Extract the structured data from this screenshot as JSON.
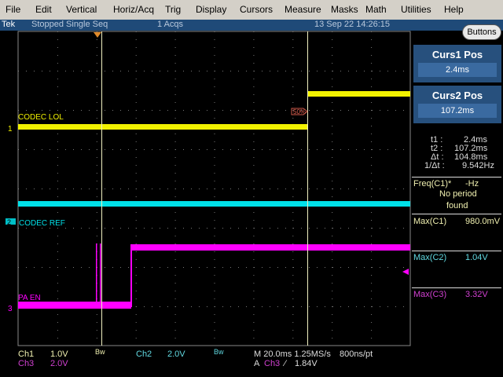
{
  "menu": [
    "File",
    "Edit",
    "Vertical",
    "Horiz/Acq",
    "Trig",
    "Display",
    "Cursors",
    "Measure",
    "Masks",
    "Math",
    "Utilities",
    "Help"
  ],
  "status": {
    "brand": "Tek",
    "state": "Stopped  Single Seq",
    "acqs": "1 Acqs",
    "datetime": "13 Sep 22 14:26:15"
  },
  "buttons_label": "Buttons",
  "cursors": {
    "curs1_title": "Curs1 Pos",
    "curs1_value": "2.4ms",
    "curs2_title": "Curs2 Pos",
    "curs2_value": "107.2ms"
  },
  "readout": {
    "t1_label": "t1 :",
    "t1": "2.4ms",
    "t2_label": "t2 :",
    "t2": "107.2ms",
    "dt_label": "Δt :",
    "dt": "104.8ms",
    "inv_label": "1/Δt :",
    "inv": "9.542Hz"
  },
  "measurements": {
    "freq_label": "Freq(C1)*",
    "freq_value": "-Hz",
    "freq_note1": "No period",
    "freq_note2": "found",
    "max1_label": "Max(C1)",
    "max1_value": "980.0mV",
    "max2_label": "Max(C2)",
    "max2_value": "1.04V",
    "max3_label": "Max(C3)",
    "max3_value": "3.32V"
  },
  "channels": {
    "ch1_label": "CODEC LOL",
    "ch1_marker": "1",
    "ch2_label": "CODEC REF",
    "ch2_marker": "2",
    "ch3_label": "PA EN",
    "ch3_marker": "3",
    "trigger_level_marker": "50%"
  },
  "bottom": {
    "ch1": "Ch1",
    "ch1_scale": "1.0V",
    "bw1": "Bw",
    "ch2": "Ch2",
    "ch2_scale": "2.0V",
    "bw2": "Bw",
    "ch3": "Ch3",
    "ch3_scale": "2.0V",
    "timebase": "M 20.0ms 1.25MS/s",
    "perpt": "800ns/pt",
    "trig_prefix": "A",
    "trig_src": "Ch3",
    "trig_slope": "∕",
    "trig_level": "1.84V"
  },
  "colors": {
    "ch1": "#f2f200",
    "ch2": "#00e0e8",
    "ch3": "#ff00ff",
    "cursor": "#f0f0c0"
  }
}
